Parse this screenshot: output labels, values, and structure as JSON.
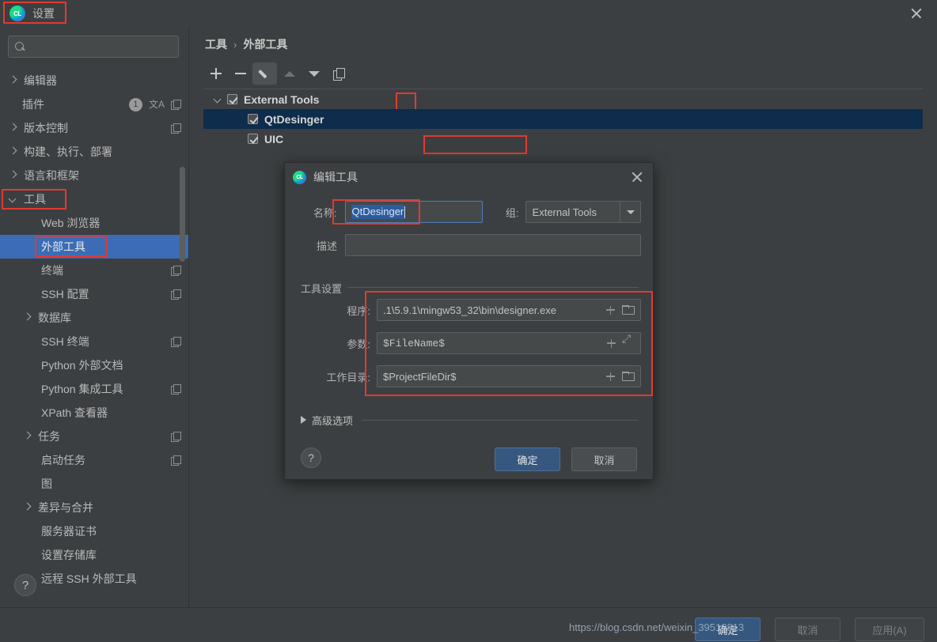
{
  "window": {
    "title": "设置",
    "logo_text": "CL",
    "close_icon": "close-icon"
  },
  "sidebar": {
    "search": {
      "value": "",
      "placeholder": ""
    },
    "items": [
      {
        "label": "编辑器",
        "arrow": "right",
        "indent": 1,
        "selected": false,
        "badges": []
      },
      {
        "label": "插件",
        "arrow": "none",
        "indent": 2,
        "selected": false,
        "badges": [
          "1",
          "translate",
          "copy"
        ]
      },
      {
        "label": "版本控制",
        "arrow": "right",
        "indent": 1,
        "selected": false,
        "badges": [
          "copy"
        ]
      },
      {
        "label": "构建、执行、部署",
        "arrow": "right",
        "indent": 1,
        "selected": false,
        "badges": []
      },
      {
        "label": "语言和框架",
        "arrow": "right",
        "indent": 1,
        "selected": false,
        "badges": []
      },
      {
        "label": "工具",
        "arrow": "down",
        "indent": 1,
        "selected": false,
        "badges": [],
        "outlined": true
      },
      {
        "label": "Web 浏览器",
        "arrow": "none",
        "indent": 3,
        "selected": false,
        "badges": []
      },
      {
        "label": "外部工具",
        "arrow": "none",
        "indent": 3,
        "selected": true,
        "badges": [],
        "outlined": true
      },
      {
        "label": "终端",
        "arrow": "none",
        "indent": 3,
        "selected": false,
        "badges": [
          "copy"
        ]
      },
      {
        "label": "SSH 配置",
        "arrow": "none",
        "indent": 3,
        "selected": false,
        "badges": [
          "copy"
        ]
      },
      {
        "label": "数据库",
        "arrow": "right",
        "indent": 2,
        "selected": false,
        "badges": []
      },
      {
        "label": "SSH 终端",
        "arrow": "none",
        "indent": 3,
        "selected": false,
        "badges": [
          "copy"
        ]
      },
      {
        "label": "Python 外部文档",
        "arrow": "none",
        "indent": 3,
        "selected": false,
        "badges": []
      },
      {
        "label": "Python 集成工具",
        "arrow": "none",
        "indent": 3,
        "selected": false,
        "badges": [
          "copy"
        ]
      },
      {
        "label": "XPath 查看器",
        "arrow": "none",
        "indent": 3,
        "selected": false,
        "badges": []
      },
      {
        "label": "任务",
        "arrow": "right",
        "indent": 2,
        "selected": false,
        "badges": [
          "copy"
        ]
      },
      {
        "label": "启动任务",
        "arrow": "none",
        "indent": 3,
        "selected": false,
        "badges": [
          "copy"
        ]
      },
      {
        "label": "图",
        "arrow": "none",
        "indent": 3,
        "selected": false,
        "badges": []
      },
      {
        "label": "差异与合并",
        "arrow": "right",
        "indent": 2,
        "selected": false,
        "badges": []
      },
      {
        "label": "服务器证书",
        "arrow": "none",
        "indent": 3,
        "selected": false,
        "badges": []
      },
      {
        "label": "设置存储库",
        "arrow": "none",
        "indent": 3,
        "selected": false,
        "badges": []
      },
      {
        "label": "远程 SSH 外部工具",
        "arrow": "none",
        "indent": 3,
        "selected": false,
        "badges": []
      }
    ],
    "help_label": "?"
  },
  "main": {
    "breadcrumb": {
      "parent": "工具",
      "separator": "›",
      "current": "外部工具"
    },
    "toolbar": [
      {
        "name": "add-button",
        "icon": "plus-icon",
        "state": "normal"
      },
      {
        "name": "remove-button",
        "icon": "minus-icon",
        "state": "normal"
      },
      {
        "name": "edit-button",
        "icon": "pencil-icon",
        "state": "active"
      },
      {
        "name": "move-up-button",
        "icon": "arrow-up-icon",
        "state": "disabled"
      },
      {
        "name": "move-down-button",
        "icon": "arrow-down-icon",
        "state": "normal"
      },
      {
        "name": "copy-button",
        "icon": "copy-icon",
        "state": "normal"
      }
    ],
    "tree": [
      {
        "label": "External Tools",
        "checked": true,
        "expanded": true,
        "level": 0,
        "selected": false
      },
      {
        "label": "QtDesinger",
        "checked": true,
        "expanded": null,
        "level": 1,
        "selected": true,
        "outlined": true
      },
      {
        "label": "UIC",
        "checked": true,
        "expanded": null,
        "level": 1,
        "selected": false
      }
    ]
  },
  "dialog": {
    "title": "编辑工具",
    "logo_text": "CL",
    "name_label": "名称:",
    "name_value": "QtDesinger",
    "group_label": "组:",
    "group_value": "External Tools",
    "description_label": "描述",
    "description_value": "",
    "settings_group_title": "工具设置",
    "program_label": "程序:",
    "program_value": ".1\\5.9.1\\mingw53_32\\bin\\designer.exe",
    "arguments_label": "参数:",
    "arguments_value": "$FileName$",
    "workdir_label": "工作目录:",
    "workdir_value": "$ProjectFileDir$",
    "advanced_label": "高级选项",
    "help_label": "?",
    "ok_label": "确定",
    "cancel_label": "取消"
  },
  "footer": {
    "ok_label": "确定",
    "cancel_label": "取消",
    "apply_label": "应用(A)"
  },
  "watermark": "https://blog.csdn.net/weixin_39510813",
  "colors": {
    "background": "#3c3f41",
    "sidebar_selection": "#3b6cb5",
    "list_selection": "#0e2c4b",
    "accent_button": "#365880",
    "highlight_outline": "#e03a32",
    "text_selection": "#2d5c9e"
  }
}
